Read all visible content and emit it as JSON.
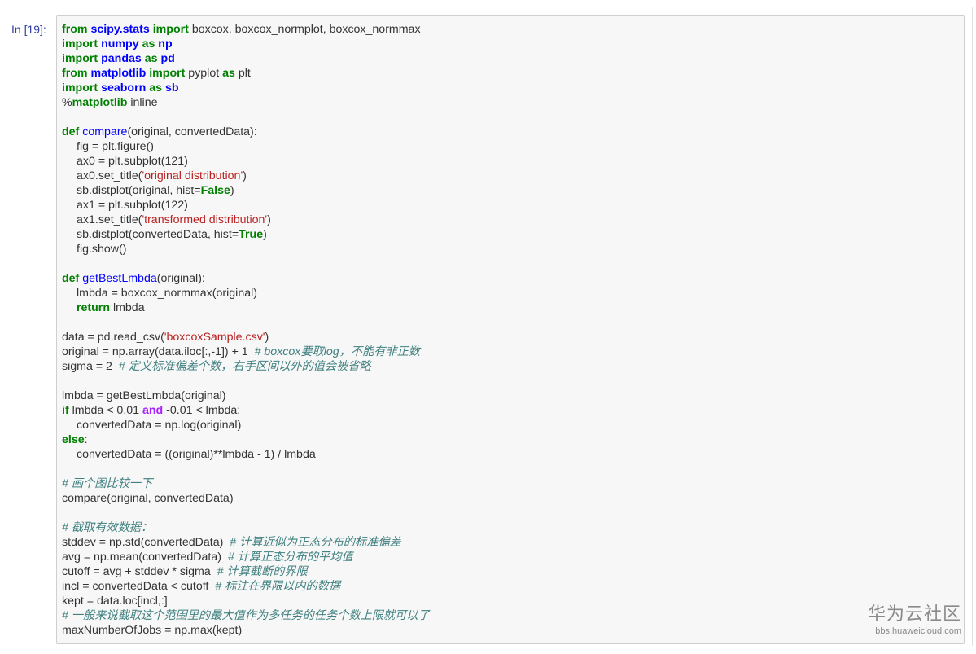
{
  "cell": {
    "prompt": "In [19]:",
    "lines": [
      [
        {
          "t": "from",
          "c": "kw"
        },
        {
          "t": " "
        },
        {
          "t": "scipy.stats",
          "c": "nm"
        },
        {
          "t": " "
        },
        {
          "t": "import",
          "c": "kw"
        },
        {
          "t": " boxcox, boxcox_normplot, boxcox_normmax"
        }
      ],
      [
        {
          "t": "import",
          "c": "kw"
        },
        {
          "t": " "
        },
        {
          "t": "numpy",
          "c": "nm"
        },
        {
          "t": " "
        },
        {
          "t": "as",
          "c": "kw"
        },
        {
          "t": " "
        },
        {
          "t": "np",
          "c": "nm"
        }
      ],
      [
        {
          "t": "import",
          "c": "kw"
        },
        {
          "t": " "
        },
        {
          "t": "pandas",
          "c": "nm"
        },
        {
          "t": " "
        },
        {
          "t": "as",
          "c": "kw"
        },
        {
          "t": " "
        },
        {
          "t": "pd",
          "c": "nm"
        }
      ],
      [
        {
          "t": "from",
          "c": "kw"
        },
        {
          "t": " "
        },
        {
          "t": "matplotlib",
          "c": "nm"
        },
        {
          "t": " "
        },
        {
          "t": "import",
          "c": "kw"
        },
        {
          "t": " pyplot "
        },
        {
          "t": "as",
          "c": "kw"
        },
        {
          "t": " plt"
        }
      ],
      [
        {
          "t": "import",
          "c": "kw"
        },
        {
          "t": " "
        },
        {
          "t": "seaborn",
          "c": "nm"
        },
        {
          "t": " "
        },
        {
          "t": "as",
          "c": "kw"
        },
        {
          "t": " "
        },
        {
          "t": "sb",
          "c": "nm"
        }
      ],
      [
        {
          "t": "%"
        },
        {
          "t": "matplotlib",
          "c": "kw"
        },
        {
          "t": " inline"
        }
      ],
      [],
      [
        {
          "t": "def",
          "c": "kw"
        },
        {
          "t": " "
        },
        {
          "t": "compare",
          "c": "fn"
        },
        {
          "t": "(original, convertedData):"
        }
      ],
      [
        {
          "ind": 1
        },
        {
          "t": "fig = plt.figure()"
        }
      ],
      [
        {
          "ind": 1
        },
        {
          "t": "ax0 = plt.subplot(121)"
        }
      ],
      [
        {
          "ind": 1
        },
        {
          "t": "ax0.set_title("
        },
        {
          "t": "'original distribution'",
          "c": "st"
        },
        {
          "t": ")"
        }
      ],
      [
        {
          "ind": 1
        },
        {
          "t": "sb.distplot(original, hist="
        },
        {
          "t": "False",
          "c": "bo"
        },
        {
          "t": ")"
        }
      ],
      [
        {
          "ind": 1
        },
        {
          "t": "ax1 = plt.subplot(122)"
        }
      ],
      [
        {
          "ind": 1
        },
        {
          "t": "ax1.set_title("
        },
        {
          "t": "'transformed distribution'",
          "c": "st"
        },
        {
          "t": ")"
        }
      ],
      [
        {
          "ind": 1
        },
        {
          "t": "sb.distplot(convertedData, hist="
        },
        {
          "t": "True",
          "c": "bo"
        },
        {
          "t": ")"
        }
      ],
      [
        {
          "ind": 1
        },
        {
          "t": "fig.show()"
        }
      ],
      [],
      [
        {
          "t": "def",
          "c": "kw"
        },
        {
          "t": " "
        },
        {
          "t": "getBestLmbda",
          "c": "fn"
        },
        {
          "t": "(original):"
        }
      ],
      [
        {
          "ind": 1
        },
        {
          "t": "lmbda = boxcox_normmax(original)"
        }
      ],
      [
        {
          "ind": 1
        },
        {
          "t": "return",
          "c": "kw"
        },
        {
          "t": " lmbda"
        }
      ],
      [],
      [
        {
          "t": "data = pd.read_csv("
        },
        {
          "t": "'boxcoxSample.csv'",
          "c": "st"
        },
        {
          "t": ")"
        }
      ],
      [
        {
          "t": "original = np.array(data.iloc[:,-1]) + 1  "
        },
        {
          "t": "# boxcox要取log，不能有非正数",
          "c": "cm"
        }
      ],
      [
        {
          "t": "sigma = 2  "
        },
        {
          "t": "# 定义标准偏差个数，右手区间以外的值会被省略",
          "c": "cm"
        }
      ],
      [],
      [
        {
          "t": "lmbda = getBestLmbda(original)"
        }
      ],
      [
        {
          "t": "if",
          "c": "kw"
        },
        {
          "t": " lmbda < 0.01 "
        },
        {
          "t": "and",
          "c": "ow"
        },
        {
          "t": " -0.01 < lmbda:"
        }
      ],
      [
        {
          "ind": 1
        },
        {
          "t": "convertedData = np.log(original)"
        }
      ],
      [
        {
          "t": "else",
          "c": "kw"
        },
        {
          "t": ":"
        }
      ],
      [
        {
          "ind": 1
        },
        {
          "t": "convertedData = ((original)**lmbda - 1) / lmbda"
        }
      ],
      [],
      [
        {
          "t": "# 画个图比较一下",
          "c": "cm"
        }
      ],
      [
        {
          "t": "compare(original, convertedData)"
        }
      ],
      [],
      [
        {
          "t": "# 截取有效数据：",
          "c": "cm"
        }
      ],
      [
        {
          "t": "stddev = np.std(convertedData)  "
        },
        {
          "t": "# 计算近似为正态分布的标准偏差",
          "c": "cm"
        }
      ],
      [
        {
          "t": "avg = np.mean(convertedData)  "
        },
        {
          "t": "# 计算正态分布的平均值",
          "c": "cm"
        }
      ],
      [
        {
          "t": "cutoff = avg + stddev * sigma  "
        },
        {
          "t": "# 计算截断的界限",
          "c": "cm"
        }
      ],
      [
        {
          "t": "incl = convertedData < cutoff  "
        },
        {
          "t": "# 标注在界限以内的数据",
          "c": "cm"
        }
      ],
      [
        {
          "t": "kept = data.loc[incl,:]"
        }
      ],
      [
        {
          "t": "# 一般来说截取这个范围里的最大值作为多任务的任务个数上限就可以了",
          "c": "cm"
        }
      ],
      [
        {
          "t": "maxNumberOfJobs = np.max(kept)"
        }
      ]
    ]
  },
  "watermark": {
    "title": "华为云社区",
    "url": "bbs.huaweicloud.com"
  }
}
